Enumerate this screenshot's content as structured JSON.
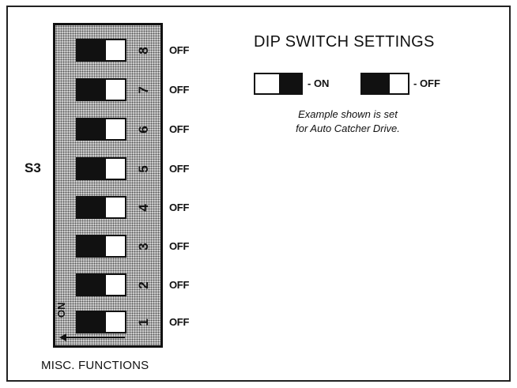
{
  "diagram": {
    "bank_label": "S3",
    "bank_caption": "MISC. FUNCTIONS",
    "on_marker": "ON",
    "switches": [
      {
        "number": "8",
        "state": "OFF"
      },
      {
        "number": "7",
        "state": "OFF"
      },
      {
        "number": "6",
        "state": "OFF"
      },
      {
        "number": "5",
        "state": "OFF"
      },
      {
        "number": "4",
        "state": "OFF"
      },
      {
        "number": "3",
        "state": "OFF"
      },
      {
        "number": "2",
        "state": "OFF"
      },
      {
        "number": "1",
        "state": "OFF"
      }
    ]
  },
  "legend": {
    "title": "DIP SWITCH SETTINGS",
    "on_label": "- ON",
    "off_label": "- OFF",
    "note_line1": "Example shown is set",
    "note_line2": "for Auto Catcher Drive."
  }
}
